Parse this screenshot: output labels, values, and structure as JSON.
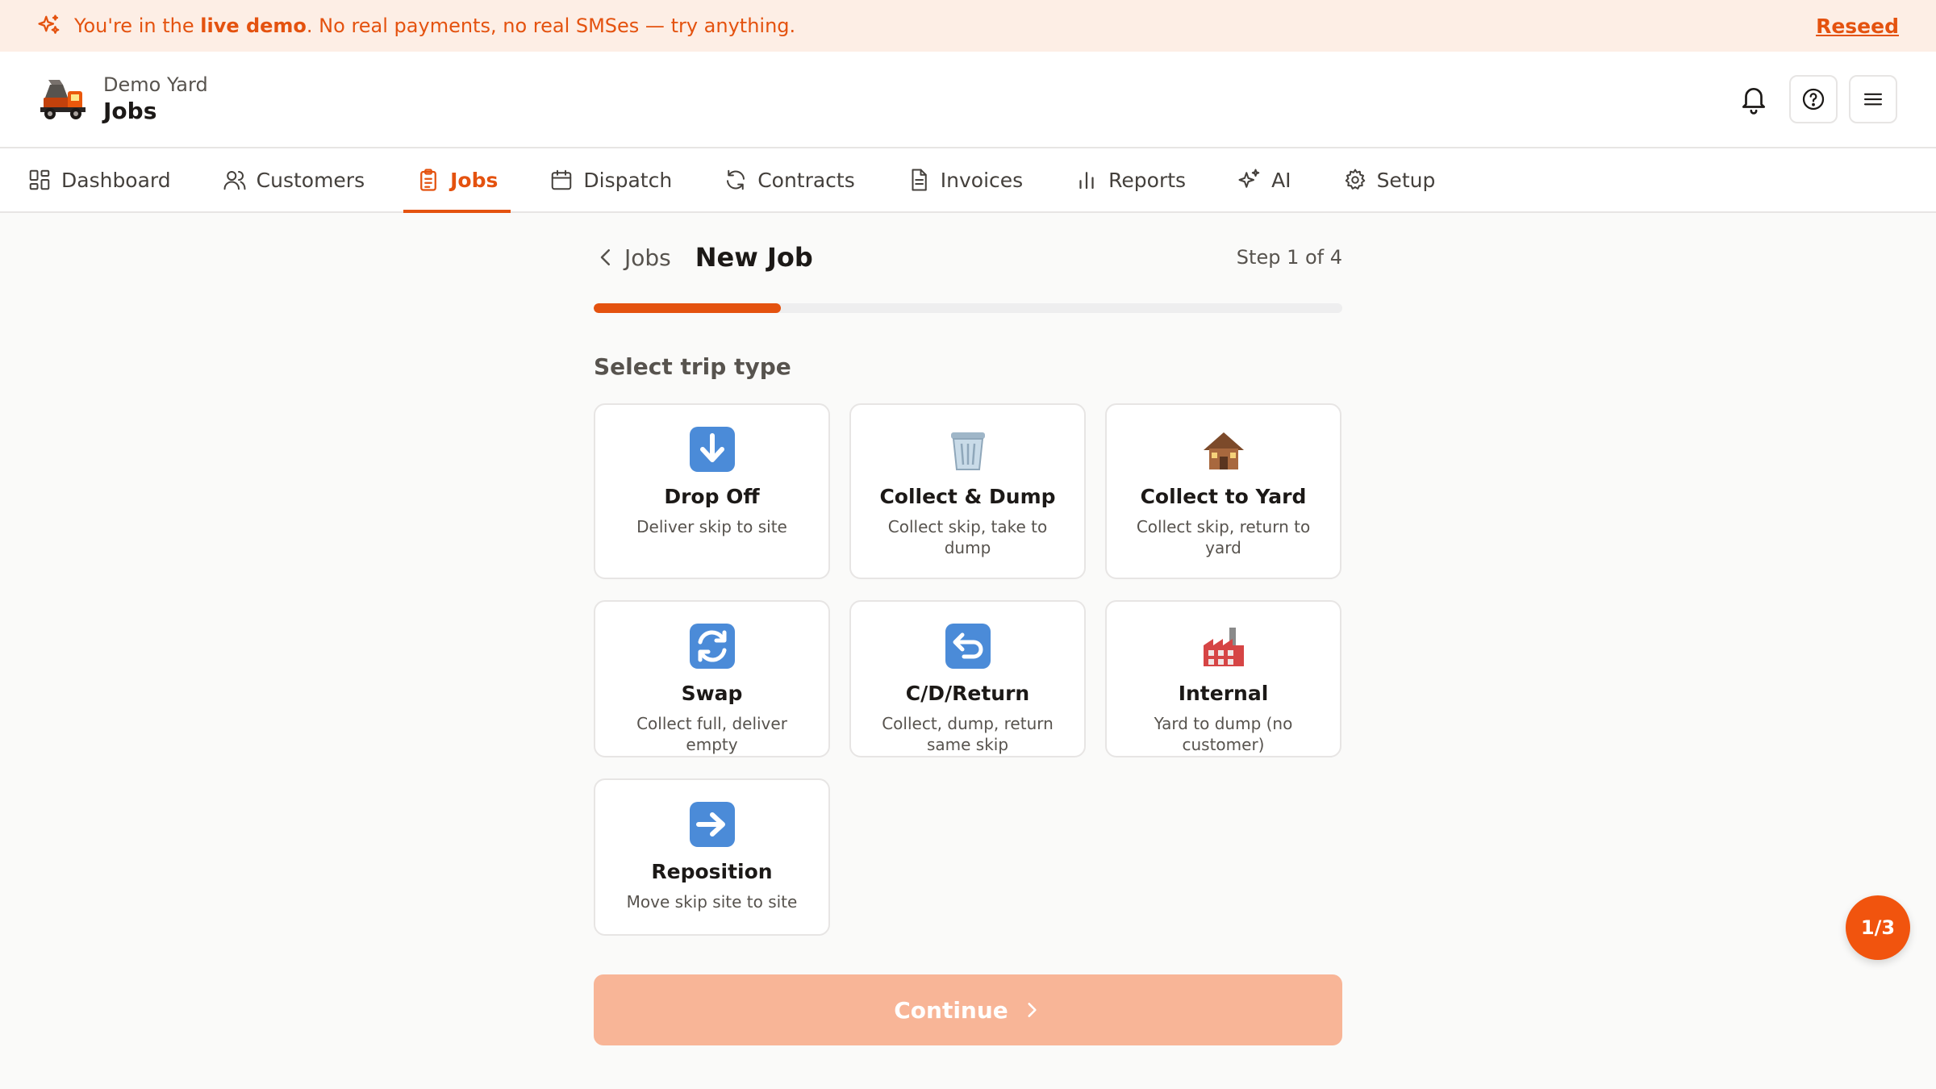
{
  "banner": {
    "prefix": "You're in the ",
    "bold": "live demo",
    "suffix": ". No real payments, no real SMSes — try anything.",
    "action": "Reseed"
  },
  "header": {
    "org": "Demo Yard",
    "title": "Jobs"
  },
  "nav": {
    "tabs": [
      {
        "label": "Dashboard",
        "icon": "dashboard-icon"
      },
      {
        "label": "Customers",
        "icon": "users-icon"
      },
      {
        "label": "Jobs",
        "icon": "clipboard-icon",
        "active": true
      },
      {
        "label": "Dispatch",
        "icon": "calendar-icon"
      },
      {
        "label": "Contracts",
        "icon": "refresh-icon"
      },
      {
        "label": "Invoices",
        "icon": "document-icon"
      },
      {
        "label": "Reports",
        "icon": "bar-chart-icon"
      },
      {
        "label": "AI",
        "icon": "sparkles-icon"
      },
      {
        "label": "Setup",
        "icon": "gear-icon"
      }
    ]
  },
  "page": {
    "back_label": "Jobs",
    "title": "New Job",
    "step_label": "Step 1 of 4",
    "progress": 0.25,
    "section_label": "Select trip type",
    "continue_label": "Continue"
  },
  "trip_types": [
    {
      "name": "Drop Off",
      "desc": "Deliver skip to site",
      "icon": "arrow-down-icon"
    },
    {
      "name": "Collect & Dump",
      "desc": "Collect skip, take to dump",
      "icon": "wastebasket-icon"
    },
    {
      "name": "Collect to Yard",
      "desc": "Collect skip, return to yard",
      "icon": "house-icon"
    },
    {
      "name": "Swap",
      "desc": "Collect full, deliver empty",
      "icon": "swap-arrows-icon"
    },
    {
      "name": "C/D/Return",
      "desc": "Collect, dump, return same skip",
      "icon": "return-arrow-icon"
    },
    {
      "name": "Internal",
      "desc": "Yard to dump (no customer)",
      "icon": "factory-icon"
    },
    {
      "name": "Reposition",
      "desc": "Move skip site to site",
      "icon": "arrow-right-icon"
    }
  ],
  "fab_label": "1/3",
  "colors": {
    "accent": "#e4520f",
    "banner_bg": "#fdeee5",
    "continue_disabled": "#f8b597"
  }
}
